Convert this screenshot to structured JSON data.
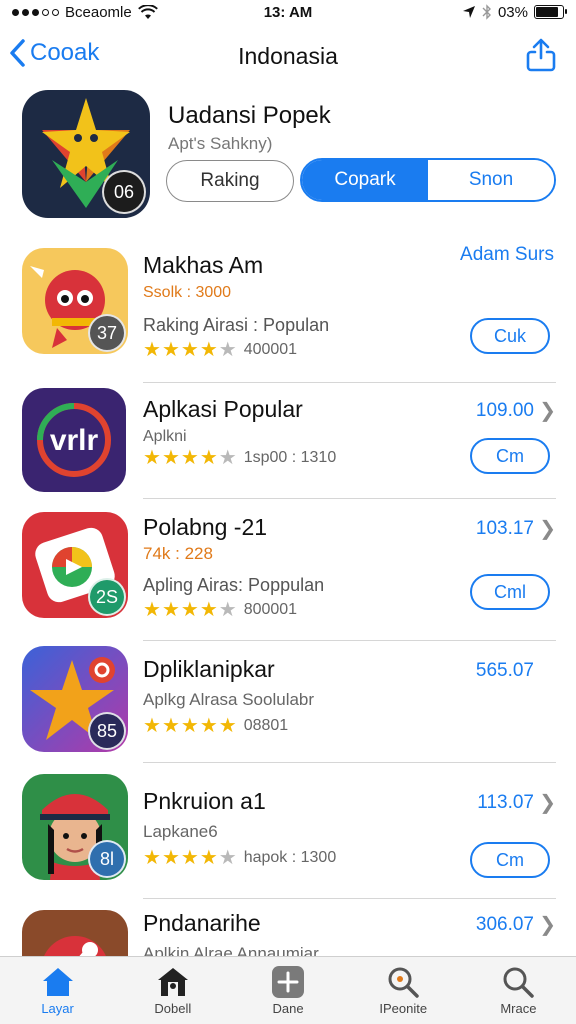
{
  "status_bar": {
    "carrier": "Bceaomle",
    "time": "13: AM",
    "battery": "03%",
    "battery_level": 0.85
  },
  "nav": {
    "back_label": "Cooak",
    "title": "Indonasia"
  },
  "hero": {
    "name": "Uadansi Popek",
    "subtitle": "Apt's Sahkny)",
    "badge": "06",
    "segment_single": "Raking",
    "segments": [
      "Copark",
      "Snon"
    ]
  },
  "colors": {
    "accent": "#1a7cf0",
    "star": "#f2b705",
    "orange": "#e07a1a"
  },
  "apps": [
    {
      "title": "Makhas Am",
      "line2": "Ssolk : 3000",
      "line3": "Raking Airasi : Populan",
      "rating_text": "400001",
      "rating": 4,
      "badge": "37",
      "price": "",
      "top_link": "Adam Surs",
      "button": "Cuk"
    },
    {
      "title": "Aplkasi Popular",
      "line2": "Aplkni",
      "line3": "",
      "rating_text": "1sp00 : 1310",
      "rating": 4,
      "badge": "",
      "price": "109.00",
      "button": "Cm"
    },
    {
      "title": "Polabng -21",
      "line2": "74k : 228",
      "line3": "Apling Airas: Poppulan",
      "rating_text": "800001",
      "rating": 4,
      "badge": "2S",
      "price": "103.17",
      "button": "Cml"
    },
    {
      "title": "Dpliklanipkar",
      "line2": "Aplkg Alrasa Soolulabr",
      "line3": "",
      "rating_text": "08801",
      "rating": 5,
      "badge": "85",
      "price": "565.07",
      "button": ""
    },
    {
      "title": "Pnkruion a1",
      "line2": "Lapkane6",
      "line3": "",
      "rating_text": "hapok : 1300",
      "rating": 4,
      "badge": "8l",
      "price": "113.07",
      "button": "Cm"
    },
    {
      "title": "Pndanarihe",
      "line2": "Aplkin Alrae Annaumiar",
      "line3": "",
      "rating_text": "",
      "rating": 0,
      "badge": "",
      "price": "306.07",
      "button": ""
    }
  ],
  "tabs": [
    {
      "label": "Layar",
      "icon": "home-icon",
      "active": true
    },
    {
      "label": "Dobell",
      "icon": "house-icon",
      "active": false
    },
    {
      "label": "Dane",
      "icon": "plus-icon",
      "active": false
    },
    {
      "label": "IPeonite",
      "icon": "search-icon",
      "active": false
    },
    {
      "label": "Mrace",
      "icon": "search-icon",
      "active": false
    }
  ]
}
